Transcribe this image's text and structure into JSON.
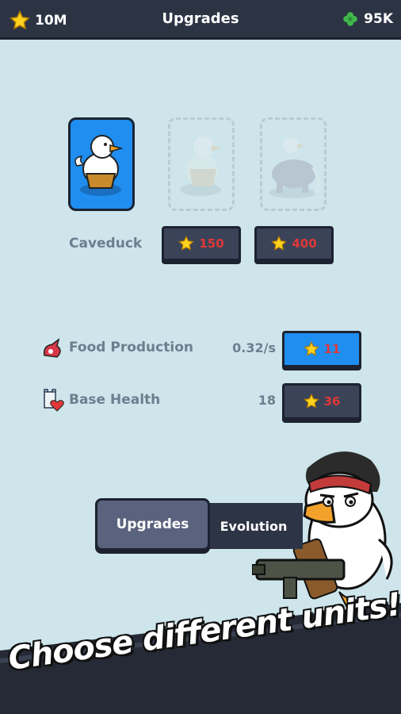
{
  "header": {
    "title": "Upgrades",
    "stars": "10M",
    "clovers": "95K"
  },
  "units": {
    "active_name": "Caveduck",
    "locked": [
      {
        "cost": "150"
      },
      {
        "cost": "400"
      }
    ]
  },
  "stats": [
    {
      "label": "Food Production",
      "value": "0.32/s",
      "cost": "11"
    },
    {
      "label": "Base Health",
      "value": "18",
      "cost": "36"
    }
  ],
  "tabs": {
    "upgrades": "Upgrades",
    "evolution": "Evolution"
  },
  "banner": {
    "text": "Choose different units!"
  },
  "colors": {
    "accent_blue": "#1f8ef0",
    "dark_panel": "#2c3444",
    "background": "#cde5eb",
    "cost_red": "#e03838",
    "star_yellow": "#ffd21f",
    "clover_green": "#3fb94a"
  }
}
